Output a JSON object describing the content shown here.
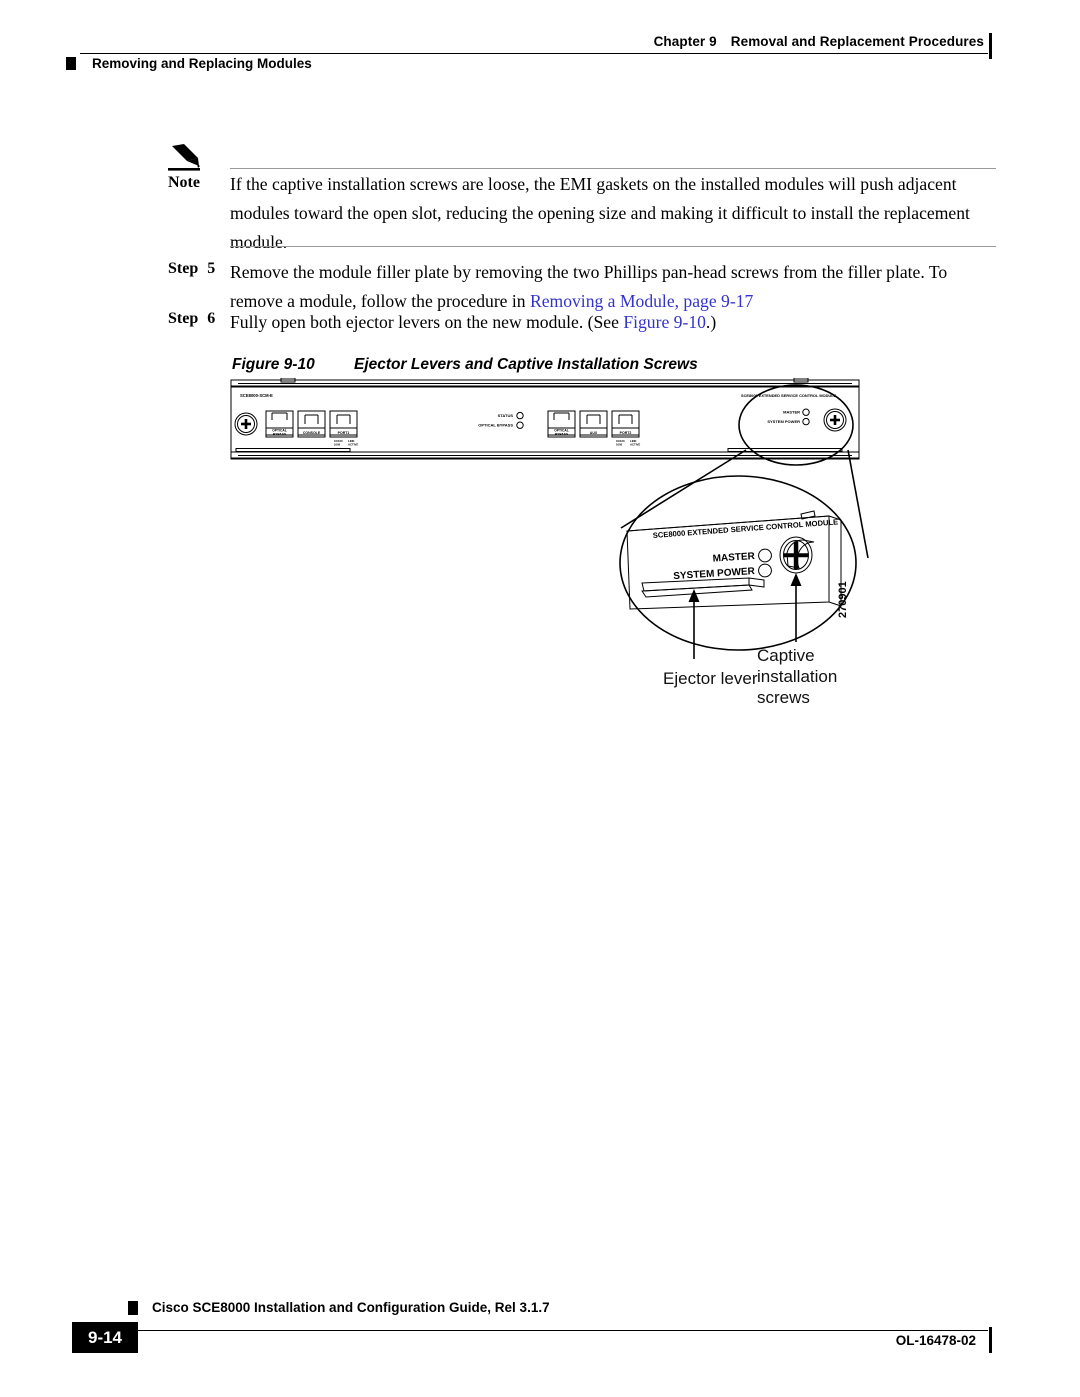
{
  "header": {
    "chapter": "Chapter 9",
    "chapter_title": "Removal and Replacement Procedures",
    "section": "Removing and Replacing Modules"
  },
  "note": {
    "label": "Note",
    "icon": "pencil-icon",
    "text": "If the captive installation screws are loose, the EMI gaskets on the installed modules will push adjacent modules toward the open slot, reducing the opening size and making it difficult to install the replacement module."
  },
  "steps": [
    {
      "label": "Step",
      "number": "5",
      "text_before": "Remove the module filler plate by removing the two Phillips pan-head screws from the filler plate. To remove a module, follow the procedure in ",
      "link": "Removing a Module, page 9-17",
      "text_after": ""
    },
    {
      "label": "Step",
      "number": "6",
      "text_before": "Fully open both ejector levers on the new module. (See ",
      "link": "Figure 9-10",
      "text_after": ".)"
    }
  ],
  "figure": {
    "number": "Figure 9-10",
    "title": "Ejector Levers and Captive Installation Screws",
    "artwork_id": "270901",
    "faceplate": {
      "part_label": "SCE8000-SCM-E",
      "module_label": "SCE8000 EXTENDED SERVICE CONTROL MODULE",
      "ports": [
        {
          "name": "OPTICAL BYPASS",
          "line1": "OPTICAL",
          "line2": "BYPASS"
        },
        {
          "name": "CONSOLE",
          "line1": "CONSOLE",
          "line2": ""
        },
        {
          "name": "PORT1",
          "line1": "PORT1",
          "line2": ""
        },
        {
          "name": "OPTICAL BYPASS",
          "line1": "OPTICAL",
          "line2": "BYPASS"
        },
        {
          "name": "AUX",
          "line1": "AUX",
          "line2": ""
        },
        {
          "name": "PORT2",
          "line1": "PORT2",
          "line2": ""
        }
      ],
      "port_led_labels": [
        {
          "a1": "10/100",
          "a2": "1000",
          "b1": "LINK",
          "b2": "ACTIVE"
        }
      ],
      "leds_center": [
        "STATUS",
        "OPTICAL BYPASS"
      ],
      "leds_right": [
        "MASTER",
        "SYSTEM POWER"
      ]
    },
    "magnified": {
      "module_label": "SCE8000 EXTENDED SERVICE CONTROL MODULE",
      "led_master": "MASTER",
      "led_system_power": "SYSTEM POWER"
    },
    "callouts": {
      "ejector_lever": "Ejector lever",
      "captive_screws_l1": "Captive",
      "captive_screws_l2": "installation",
      "captive_screws_l3": "screws"
    }
  },
  "footer": {
    "guide_title": "Cisco SCE8000 Installation and Configuration Guide, Rel 3.1.7",
    "page_number": "9-14",
    "doc_number": "OL-16478-02"
  },
  "colors": {
    "link": "#3333cc",
    "text": "#000000",
    "rule": "#9a9a9a"
  }
}
